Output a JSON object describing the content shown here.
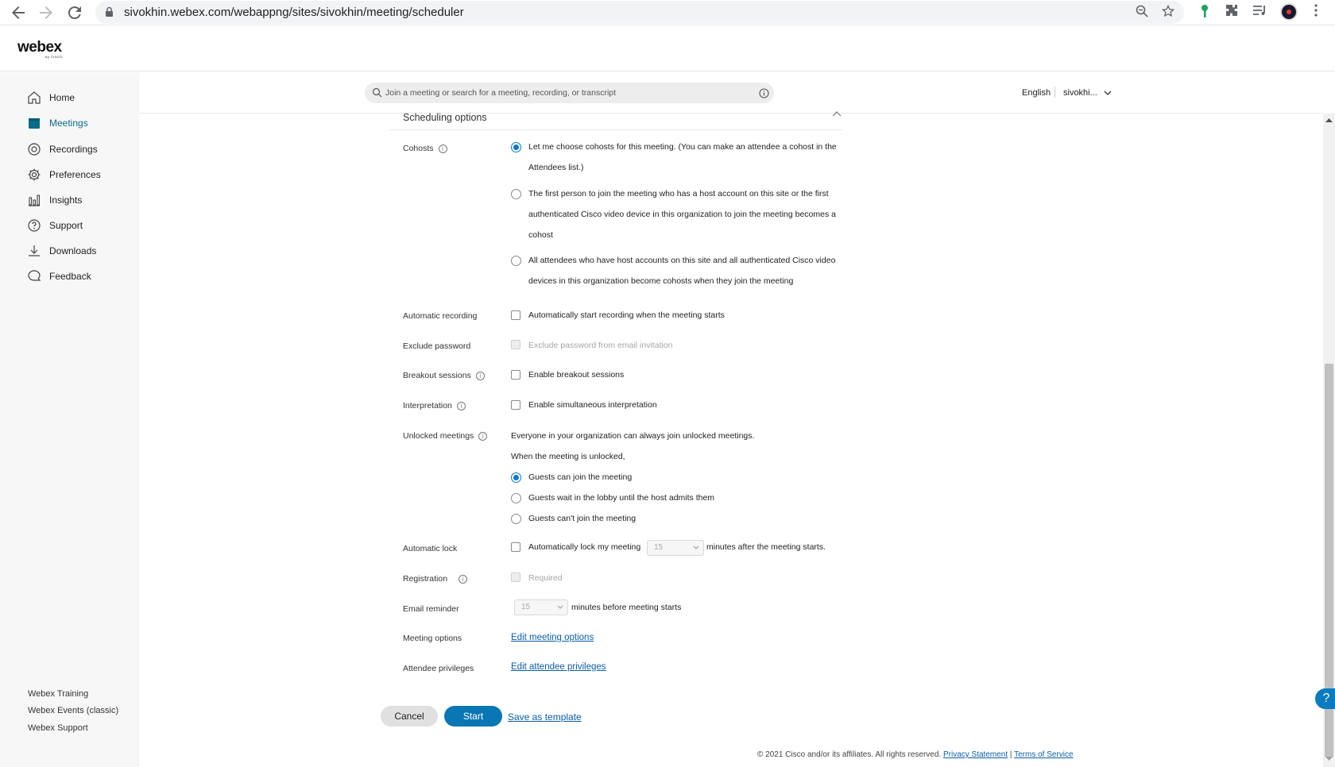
{
  "browser": {
    "url": "sivokhin.webex.com/webappng/sites/sivokhin/meeting/scheduler"
  },
  "header": {
    "logo": "webex",
    "logo_sub": "by CISCO",
    "search_placeholder": "Join a meeting or search for a meeting, recording, or transcript",
    "language": "English",
    "user": "sivokhi..."
  },
  "sidebar": {
    "items": [
      {
        "label": "Home",
        "icon": "home-icon"
      },
      {
        "label": "Meetings",
        "icon": "calendar-icon",
        "active": true
      },
      {
        "label": "Recordings",
        "icon": "recording-icon"
      },
      {
        "label": "Preferences",
        "icon": "gear-icon"
      },
      {
        "label": "Insights",
        "icon": "bar-chart-icon"
      },
      {
        "label": "Support",
        "icon": "help-icon"
      },
      {
        "label": "Downloads",
        "icon": "download-icon"
      },
      {
        "label": "Feedback",
        "icon": "chat-icon"
      }
    ],
    "footer_links": [
      "Webex Training",
      "Webex Events (classic)",
      "Webex Support"
    ]
  },
  "scheduling": {
    "title": "Scheduling options",
    "cohosts": {
      "label": "Cohosts",
      "options": [
        {
          "line1": "Let me choose cohosts for this meeting. (You can make an attendee a cohost in the",
          "line2": "Attendees list.)",
          "selected": true
        },
        {
          "line1": "The first person to join the meeting who has a host account on this site or the first",
          "line2": "authenticated Cisco video device in this organization to join the meeting becomes a",
          "line3": "cohost",
          "selected": false
        },
        {
          "line1": "All attendees who have host accounts on this site and all authenticated Cisco video",
          "line2": "devices in this organization become cohosts when they join the meeting",
          "selected": false
        }
      ]
    },
    "automatic_recording": {
      "label": "Automatic recording",
      "option": "Automatically start recording when the meeting starts"
    },
    "exclude_password": {
      "label": "Exclude password",
      "option": "Exclude password from email invitation"
    },
    "breakout_sessions": {
      "label": "Breakout sessions",
      "option": "Enable breakout sessions"
    },
    "interpretation": {
      "label": "Interpretation",
      "option": "Enable simultaneous interpretation"
    },
    "unlocked_meetings": {
      "label": "Unlocked meetings",
      "desc1": "Everyone in your organization can always join unlocked meetings.",
      "desc2": "When the meeting is unlocked,",
      "options": [
        {
          "label": "Guests can join the meeting",
          "selected": true
        },
        {
          "label": "Guests wait in the lobby until the host admits them",
          "selected": false
        },
        {
          "label": "Guests can't join the meeting",
          "selected": false
        }
      ]
    },
    "automatic_lock": {
      "label": "Automatic lock",
      "option_pre": "Automatically lock my meeting",
      "value": "15",
      "option_post": "minutes after the meeting starts."
    },
    "registration": {
      "label": "Registration",
      "option": "Required"
    },
    "email_reminder": {
      "label": "Email reminder",
      "value": "15",
      "option_post": "minutes before meeting starts"
    },
    "meeting_options": {
      "label": "Meeting options",
      "link": "Edit meeting options"
    },
    "attendee_privileges": {
      "label": "Attendee privileges",
      "link": "Edit attendee privileges"
    }
  },
  "actions": {
    "cancel": "Cancel",
    "start": "Start",
    "save_template": "Save as template"
  },
  "footer": {
    "copyright": "© 2021 Cisco and/or its affiliates. All rights reserved.",
    "privacy": "Privacy Statement",
    "terms": "Terms of Service"
  },
  "help_fab": "?"
}
